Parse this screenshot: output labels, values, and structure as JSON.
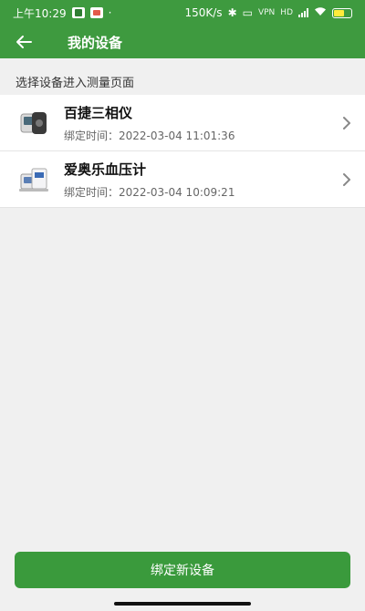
{
  "status_bar": {
    "time": "上午10:29",
    "speed": "150K/s",
    "vpn": "VPN",
    "hd": "HD"
  },
  "header": {
    "title": "我的设备"
  },
  "section_label": "选择设备进入测量页面",
  "devices": [
    {
      "name": "百捷三相仪",
      "bind_time": "绑定时间：2022-03-04 11:01:36"
    },
    {
      "name": "爱奥乐血压计",
      "bind_time": "绑定时间：2022-03-04 10:09:21"
    }
  ],
  "bind_button_label": "绑定新设备",
  "colors": {
    "primary": "#3e9a3f",
    "button": "#3a9a3c",
    "background": "#f0f0f0"
  },
  "icons": {
    "back": "back-arrow-icon",
    "chevron": "chevron-right-icon"
  }
}
